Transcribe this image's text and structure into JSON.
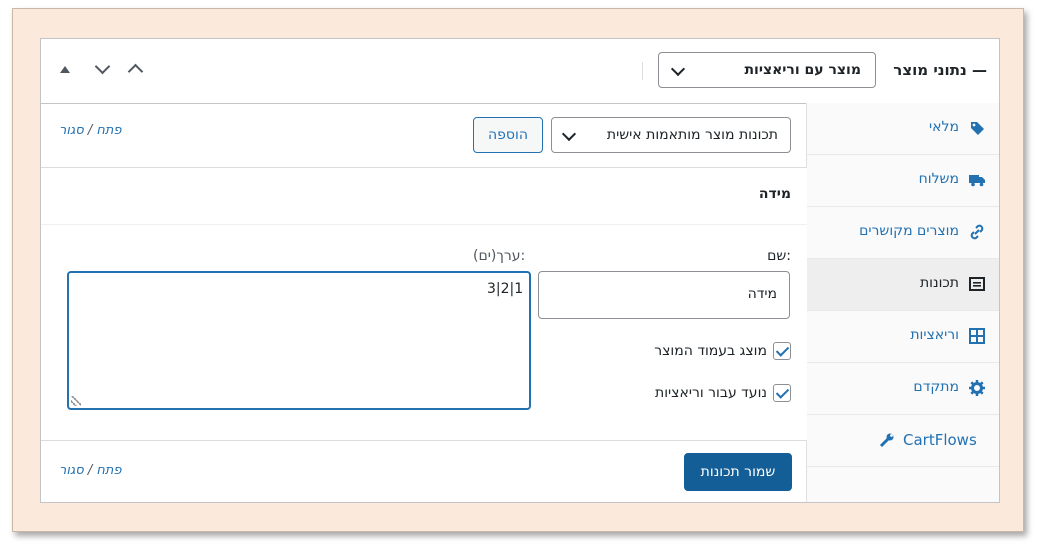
{
  "header": {
    "title": "נתוני מוצר —",
    "product_type": "מוצר עם וריאציות"
  },
  "tabs": [
    {
      "label": "מלאי",
      "icon": "tag-icon"
    },
    {
      "label": "משלוח",
      "icon": "truck-icon"
    },
    {
      "label": "מוצרים מקושרים",
      "icon": "link-icon"
    },
    {
      "label": "תכונות",
      "icon": "list-icon",
      "active": true
    },
    {
      "label": "וריאציות",
      "icon": "grid-icon"
    },
    {
      "label": "מתקדם",
      "icon": "gear-icon"
    },
    {
      "label": "CartFlows",
      "icon": "wrench-icon"
    }
  ],
  "toolbar": {
    "attribute_select": "תכונות מוצר מותאמות אישית",
    "add_label": "הוספה",
    "expand": "פתח",
    "close": "סגור",
    "separator": "/"
  },
  "attribute": {
    "title": "מידה",
    "name_label": "שם:",
    "name_value": "מידה",
    "values_label": "ערך(ים):",
    "values_value": "3|2|1",
    "visible_label": "מוצג בעמוד המוצר",
    "variation_label": "נועד עבור וריאציות"
  },
  "footer": {
    "save_label": "שמור תכונות"
  },
  "colors": {
    "accent": "#2271b1",
    "primary_button": "#135e96",
    "frame_background": "#fbeadc"
  }
}
